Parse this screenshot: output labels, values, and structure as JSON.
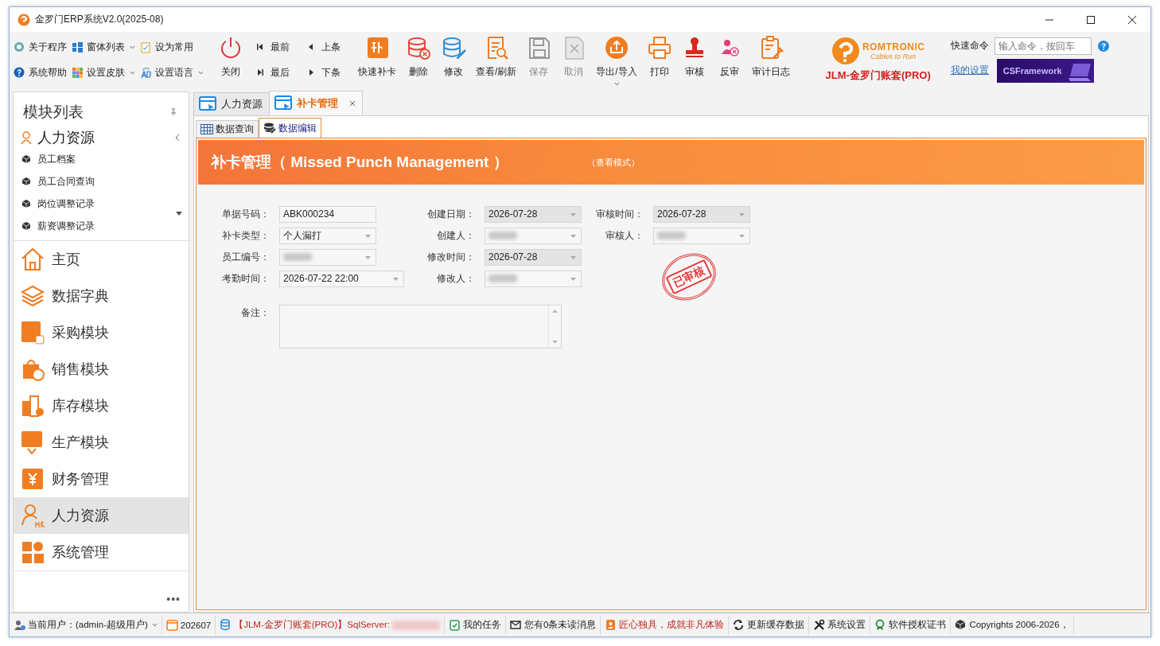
{
  "window": {
    "title": "金罗门ERP系统V2.0(2025-08)"
  },
  "toolbar": {
    "small_items": [
      {
        "label": "关于程序",
        "dropdown": false
      },
      {
        "label": "窗体列表",
        "dropdown": true
      },
      {
        "label": "设为常用",
        "dropdown": false
      },
      {
        "label": "系统帮助",
        "dropdown": false
      },
      {
        "label": "设置皮肤",
        "dropdown": true
      },
      {
        "label": "设置语言",
        "dropdown": true
      }
    ],
    "close": "关闭",
    "nav": [
      "最前",
      "上条",
      "最后",
      "下条"
    ],
    "buttons": [
      {
        "label": "快速补卡",
        "disabled": false,
        "dropdown": false
      },
      {
        "label": "删除",
        "disabled": false,
        "dropdown": false
      },
      {
        "label": "修改",
        "disabled": false,
        "dropdown": false
      },
      {
        "label": "查看/刷新",
        "disabled": false,
        "dropdown": false
      },
      {
        "label": "保存",
        "disabled": true,
        "dropdown": false
      },
      {
        "label": "取消",
        "disabled": true,
        "dropdown": false
      },
      {
        "label": "导出/导入",
        "disabled": false,
        "dropdown": true
      },
      {
        "label": "打印",
        "disabled": false,
        "dropdown": false
      },
      {
        "label": "审核",
        "disabled": false,
        "dropdown": false
      },
      {
        "label": "反审",
        "disabled": false,
        "dropdown": false
      },
      {
        "label": "审计日志",
        "disabled": false,
        "dropdown": false
      }
    ]
  },
  "brand": {
    "name": "ROMTRONIC",
    "slogan": "Cables to Run",
    "account": "JLM-金罗门账套(PRO)"
  },
  "quick_command": {
    "label": "快速命令",
    "placeholder": "输入命令，按回车"
  },
  "my_settings": "我的设置",
  "banner": "CSFramework",
  "sidebar": {
    "title": "模块列表",
    "group": {
      "label": "人力资源",
      "expanded": true,
      "items": [
        "员工档案",
        "员工合同查询",
        "岗位调整记录",
        "薪资调整记录"
      ]
    },
    "modules": [
      {
        "label": "主页",
        "selected": false
      },
      {
        "label": "数据字典",
        "selected": false
      },
      {
        "label": "采购模块",
        "selected": false
      },
      {
        "label": "销售模块",
        "selected": false
      },
      {
        "label": "库存模块",
        "selected": false
      },
      {
        "label": "生产模块",
        "selected": false
      },
      {
        "label": "财务管理",
        "selected": false
      },
      {
        "label": "人力资源",
        "selected": true
      },
      {
        "label": "系统管理",
        "selected": false
      }
    ],
    "more": "•••"
  },
  "tabs": [
    {
      "label": "人力资源",
      "selected": false,
      "closable": false
    },
    {
      "label": "补卡管理",
      "selected": true,
      "closable": true
    }
  ],
  "subtabs": [
    {
      "label": "数据查询",
      "selected": false
    },
    {
      "label": "数据编辑",
      "selected": true
    }
  ],
  "form": {
    "title": "补卡管理（ Missed Punch Management ）",
    "mode": "（查看模式）",
    "columns": [
      [
        {
          "label": "单据号码：",
          "value": "ABK000234",
          "kind": "text",
          "disabled": false,
          "redacted": false
        },
        {
          "label": "补卡类型：",
          "value": "个人漏打",
          "kind": "combo",
          "disabled": false,
          "redacted": false
        },
        {
          "label": "员工编号：",
          "kind": "combo",
          "disabled": false,
          "redacted": true
        },
        {
          "label": "考勤时间：",
          "value": "2026-07-22 22:00",
          "kind": "wide_combo",
          "disabled": false,
          "redacted": false
        }
      ],
      [
        {
          "label": "创建日期：",
          "value": "2026-07-28",
          "kind": "combo",
          "disabled": true,
          "redacted": false
        },
        {
          "label": "创建人：",
          "kind": "combo",
          "disabled": false,
          "redacted": true
        },
        {
          "label": "修改时间：",
          "value": "2026-07-28",
          "kind": "combo",
          "disabled": true,
          "redacted": false
        },
        {
          "label": "修改人：",
          "kind": "combo",
          "disabled": false,
          "redacted": true
        }
      ],
      [
        {
          "label": "审核时间：",
          "value": "2026-07-28",
          "kind": "combo",
          "disabled": true,
          "redacted": false
        },
        {
          "label": "审核人：",
          "kind": "combo",
          "disabled": false,
          "redacted": true
        }
      ]
    ],
    "remark": {
      "label": "备注："
    },
    "stamp": "已审核"
  },
  "status_bar": [
    {
      "label": "当前用户：(admin-超级用户)",
      "dropdown": true,
      "emphasis": false,
      "redacted": false
    },
    {
      "label": "202607",
      "dropdown": false,
      "emphasis": false,
      "redacted": false
    },
    {
      "label": "【JLM-金罗门账套(PRO)】SqlServer:",
      "dropdown": false,
      "emphasis": true,
      "redacted": true
    },
    {
      "label": "我的任务",
      "dropdown": false,
      "emphasis": false,
      "redacted": false
    },
    {
      "label": "您有0条未读消息",
      "dropdown": false,
      "emphasis": false,
      "redacted": false
    },
    {
      "label": "匠心独具，成就非凡体验",
      "dropdown": false,
      "emphasis": true,
      "redacted": false
    },
    {
      "label": "更新缓存数据",
      "dropdown": false,
      "emphasis": false,
      "redacted": false
    },
    {
      "label": "系统设置",
      "dropdown": false,
      "emphasis": false,
      "redacted": false
    },
    {
      "label": "软件授权证书",
      "dropdown": false,
      "emphasis": false,
      "redacted": false
    },
    {
      "label": "Copyrights 2006-2026，",
      "dropdown": false,
      "emphasis": false,
      "redacted": false
    }
  ]
}
